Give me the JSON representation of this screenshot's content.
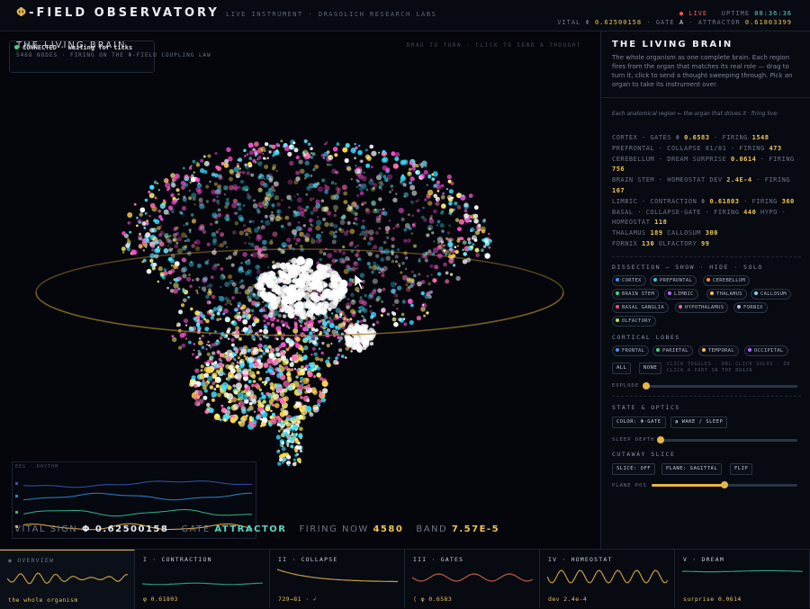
{
  "header": {
    "brand_phi": "Φ",
    "brand_text": "-FIELD OBSERVATORY",
    "subtitle": "LIVE INSTRUMENT · DRAGOLICH RESEARCH LABS",
    "live": "● LIVE",
    "uptime_label": "UPTIME",
    "uptime": "00:36:36",
    "vital_label": "VITAL Φ",
    "vital": "0.62500158",
    "gate_label": "· GATE",
    "gate": "A",
    "attractor_label": "· ATTRACTOR",
    "attractor": "0.61803399"
  },
  "stage": {
    "title": "THE LIVING BRAIN",
    "connection": "CONNECTED · waiting for ticks",
    "subtitle": "5468 NODES · FIRING ON THE Φ-FIELD COUPLING LAW",
    "hint": "DRAG TO TURN · CLICK TO SEND A THOUGHT",
    "eeg_label": "EEG · RHYTHM",
    "vital_label": "VITAL SIGN",
    "vital_value": "Φ 0.62500158",
    "gate_label": "GATE",
    "gate_value": "ATTRACTOR",
    "firing_label": "FIRING NOW",
    "firing_value": "4580",
    "band_label": "BAND",
    "band_value": "7.57E-5"
  },
  "panel": {
    "title": "THE LIVING BRAIN",
    "description": "The whole organism as one complete brain. Each region fires from the organ that matches its real role — drag to turn it, click to send a thought sweeping through. Pick an organ to take its instrument over.",
    "note": "Each anatomical region ← the organ that drives it · firing live:",
    "stats": [
      {
        "text": "CORTEX · GATES Φ ",
        "v1": "0.6583",
        "mid": " · FIRING ",
        "v2": "1548"
      },
      {
        "text": "PREFRONTAL · COLLAPSE 81/81 · FIRING ",
        "v1": "473",
        "mid": "",
        "v2": ""
      },
      {
        "text": "CEREBELLUM · DREAM SURPRISE ",
        "v1": "0.0614",
        "mid": " · FIRING ",
        "v2": "756"
      },
      {
        "text": "BRAIN STEM · HOMEOSTAT DEV ",
        "v1": "2.4E-4",
        "mid": " · FIRING ",
        "v2": "167"
      },
      {
        "text": "LIMBIC · CONTRACTION Φ ",
        "v1": "0.61803",
        "mid": " · FIRING ",
        "v2": "360"
      },
      {
        "text": "BASAL · COLLAPSE-GATE · FIRING ",
        "v1": "440",
        "mid": "  HYPO · HOMEOSTAT ",
        "v2": "118"
      },
      {
        "text": "THALAMUS ",
        "v1": "189",
        "mid": "  CALLOSUM ",
        "v2": "300"
      },
      {
        "text": "FORNIX ",
        "v1": "130",
        "mid": "  OLFACTORY ",
        "v2": "99"
      }
    ],
    "dissection_title": "DISSECTION — SHOW · HIDE · SOLO",
    "organs": [
      {
        "label": "CORTEX",
        "color": "#4a8cff"
      },
      {
        "label": "PREFRONTAL",
        "color": "#36c6e0"
      },
      {
        "label": "CEREBELLUM",
        "color": "#ff8a3d"
      },
      {
        "label": "BRAIN STEM",
        "color": "#3fd77a"
      },
      {
        "label": "LIMBIC",
        "color": "#b06cff"
      },
      {
        "label": "THALAMUS",
        "color": "#f0c552"
      },
      {
        "label": "CALLOSUM",
        "color": "#7fd3ff"
      },
      {
        "label": "BASAL GANGLIA",
        "color": "#ff4f6d"
      },
      {
        "label": "HYPOTHALAMUS",
        "color": "#ff5ab0"
      },
      {
        "label": "FORNIX",
        "color": "#c8b6ff"
      },
      {
        "label": "OLFACTORY",
        "color": "#b7e34a"
      }
    ],
    "lobes_title": "CORTICAL LOBES",
    "lobes": [
      {
        "label": "FRONTAL",
        "color": "#4a8cff"
      },
      {
        "label": "PARIETAL",
        "color": "#3fd77a"
      },
      {
        "label": "TEMPORAL",
        "color": "#f0c552"
      },
      {
        "label": "OCCIPITAL",
        "color": "#b06cff"
      }
    ],
    "all_label": "ALL",
    "none_label": "NONE",
    "toggle_hint_1": "CLICK TOGGLES · DBL-CLICK SOLOS · OR",
    "toggle_hint_2": "CLICK A PART IN THE BRAIN",
    "explode_label": "EXPLODE",
    "explode_value": 0,
    "state_title": "STATE & OPTICS",
    "color_button": "COLOR: Φ-GATE",
    "wake_button": "◑ WAKE / SLEEP",
    "sleep_label": "SLEEP DEPTH",
    "sleep_value": 0,
    "cutaway_title": "CUTAWAY SLICE",
    "slice_button": "SLICE: OFF",
    "plane_button": "PLANE: SAGITTAL",
    "flip_button": "FLIP",
    "plane_label": "PLANE POS",
    "plane_value": 0.5
  },
  "tabs": [
    {
      "title": "◉ OVERVIEW",
      "value": "the whole organism",
      "color": "#e7b54a",
      "active": true
    },
    {
      "title": "I · CONTRACTION",
      "value": "φ 0.61803",
      "color": "#2fb58a",
      "active": false
    },
    {
      "title": "II · COLLAPSE",
      "value": "729→81 · ✓",
      "color": "#e7b54a",
      "active": false
    },
    {
      "title": "III · GATES",
      "value": "⟨ φ 0.6583",
      "color": "#e06b4c",
      "active": false
    },
    {
      "title": "IV · HOMEOSTAT",
      "value": "dev 2.4e-4",
      "color": "#e7b54a",
      "active": false
    },
    {
      "title": "V · DREAM",
      "value": "surprise 0.0614",
      "color": "#2fb58a",
      "active": false
    }
  ]
}
